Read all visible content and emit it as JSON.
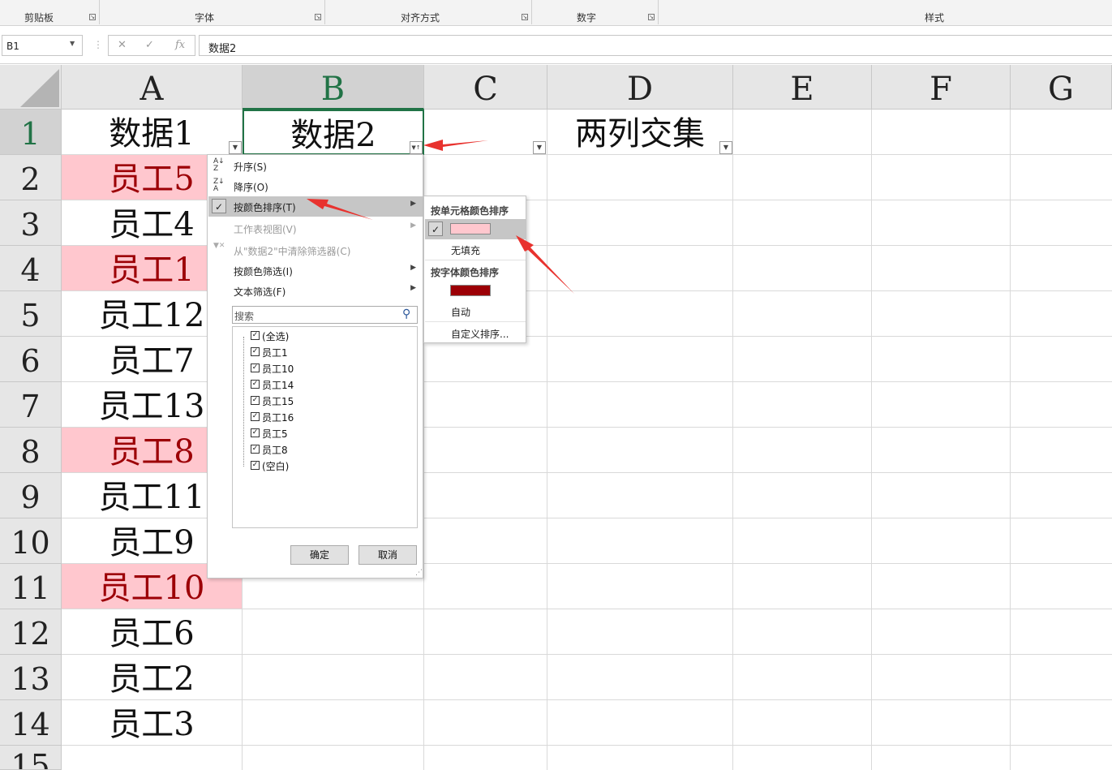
{
  "ribbon": {
    "groups": [
      "剪贴板",
      "字体",
      "对齐方式",
      "数字",
      "样式"
    ]
  },
  "formula_bar": {
    "name_box": "B1",
    "formula": "数据2"
  },
  "columns": [
    "A",
    "B",
    "C",
    "D",
    "E",
    "F",
    "G"
  ],
  "rows": [
    "1",
    "2",
    "3",
    "4",
    "5",
    "6",
    "7",
    "8",
    "9",
    "10",
    "11",
    "12",
    "13",
    "14",
    "15"
  ],
  "cells": {
    "A1": "数据1",
    "B1": "数据2",
    "D1": "两列交集",
    "A": [
      "员工5",
      "员工4",
      "员工1",
      "员工12",
      "员工7",
      "员工13",
      "员工8",
      "员工11",
      "员工9",
      "员工10",
      "员工6",
      "员工2",
      "员工3"
    ]
  },
  "colors": {
    "pink_fill": "#ffc7ce",
    "dark_red_font": "#9c0006",
    "selected_header": "#217346",
    "arrow_red": "#e8322e"
  },
  "filter_menu": {
    "sort_asc": "升序(S)",
    "sort_desc": "降序(O)",
    "sort_by_color": "按颜色排序(T)",
    "sheet_view": "工作表视图(V)",
    "clear_filter": "从\"数据2\"中清除筛选器(C)",
    "filter_by_color": "按颜色筛选(I)",
    "text_filter": "文本筛选(F)",
    "search_placeholder": "搜索",
    "items": [
      "(全选)",
      "员工1",
      "员工10",
      "员工14",
      "员工15",
      "员工16",
      "员工5",
      "员工8",
      "(空白)"
    ],
    "ok": "确定",
    "cancel": "取消"
  },
  "color_submenu": {
    "cell_color_header": "按单元格颜色排序",
    "no_fill": "无填充",
    "font_color_header": "按字体颜色排序",
    "auto": "自动",
    "custom_sort": "自定义排序..."
  }
}
